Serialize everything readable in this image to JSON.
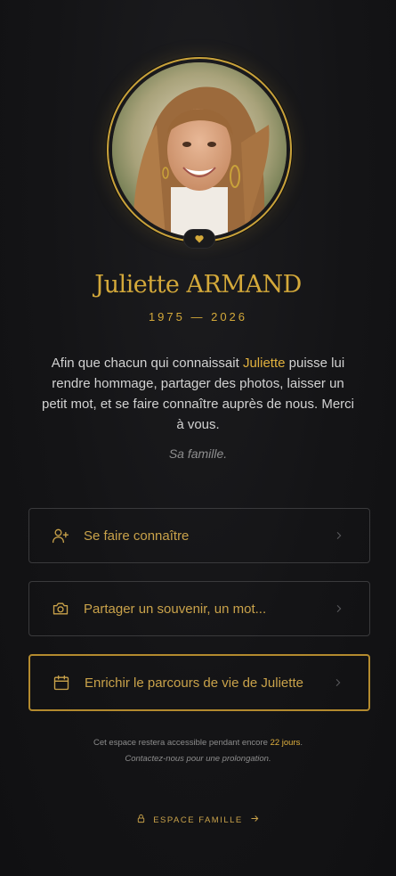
{
  "profile": {
    "name": "Juliette ARMAND",
    "dates": "1975 — 2026",
    "photo": "portrait-photo"
  },
  "intro": {
    "part1": "Afin que chacun qui connaissait ",
    "highlight": "Juliette",
    "part2": " puisse lui rendre hommage, partager des photos, laisser un petit mot, et se faire connaître auprès de nous. Merci à vous.",
    "signature": "Sa famille."
  },
  "actions": [
    {
      "label": "Se faire connaître",
      "icon": "user-plus-icon"
    },
    {
      "label": "Partager un souvenir, un mot...",
      "icon": "camera-icon"
    },
    {
      "label": "Enrichir le parcours de vie de Juliette",
      "icon": "calendar-icon"
    }
  ],
  "footer": {
    "note_part1": "Cet espace restera accessible pendant encore ",
    "note_days": "22 jours",
    "note_part2": ".",
    "note_line2": "Contactez-nous pour une prolongation.",
    "family_link": "ESPACE FAMILLE"
  },
  "colors": {
    "accent": "#d4a93a",
    "background": "#141416",
    "border": "#3a3a3c"
  }
}
